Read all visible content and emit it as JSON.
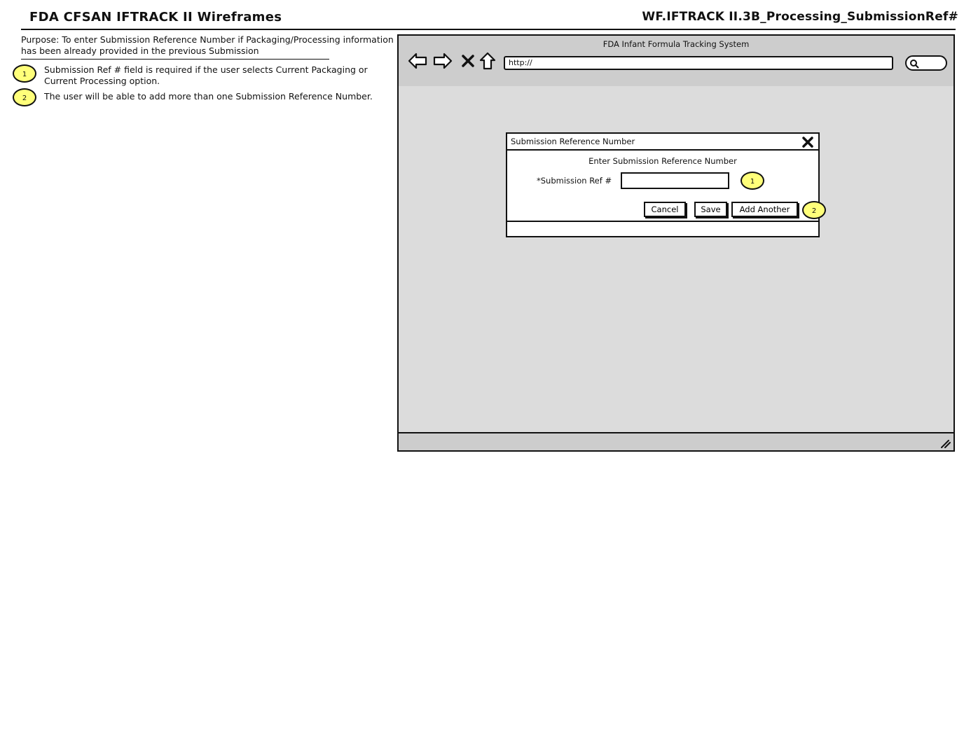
{
  "header": {
    "title": "FDA CFSAN IFTRACK II Wireframes",
    "page_id": "WF.IFTRACK II.3B_Processing_SubmissionRef#"
  },
  "notes": {
    "purpose": "Purpose: To enter Submission Reference Number if Packaging/Processing information has been already provided in the previous Submission",
    "items": [
      {
        "badge": "1",
        "text": "Submission Ref # field is required if the user selects Current Packaging or Current Processing option."
      },
      {
        "badge": "2",
        "text": "The user will be able to add more than one Submission Reference Number."
      }
    ]
  },
  "browser": {
    "title": "FDA Infant Formula Tracking System",
    "url": "http://"
  },
  "dialog": {
    "title": "Submission Reference Number",
    "heading": "Enter Submission Reference Number",
    "field_label": "*Submission Ref #",
    "field_value": "",
    "cancel_label": "Cancel",
    "save_label": "Save",
    "add_another_label": "Add Another",
    "callout_field": "1",
    "callout_buttons": "2"
  },
  "colors": {
    "callout": "#ffff7a",
    "browser_bg": "#dcdcdc",
    "chrome_bg": "#cdcdcd"
  }
}
